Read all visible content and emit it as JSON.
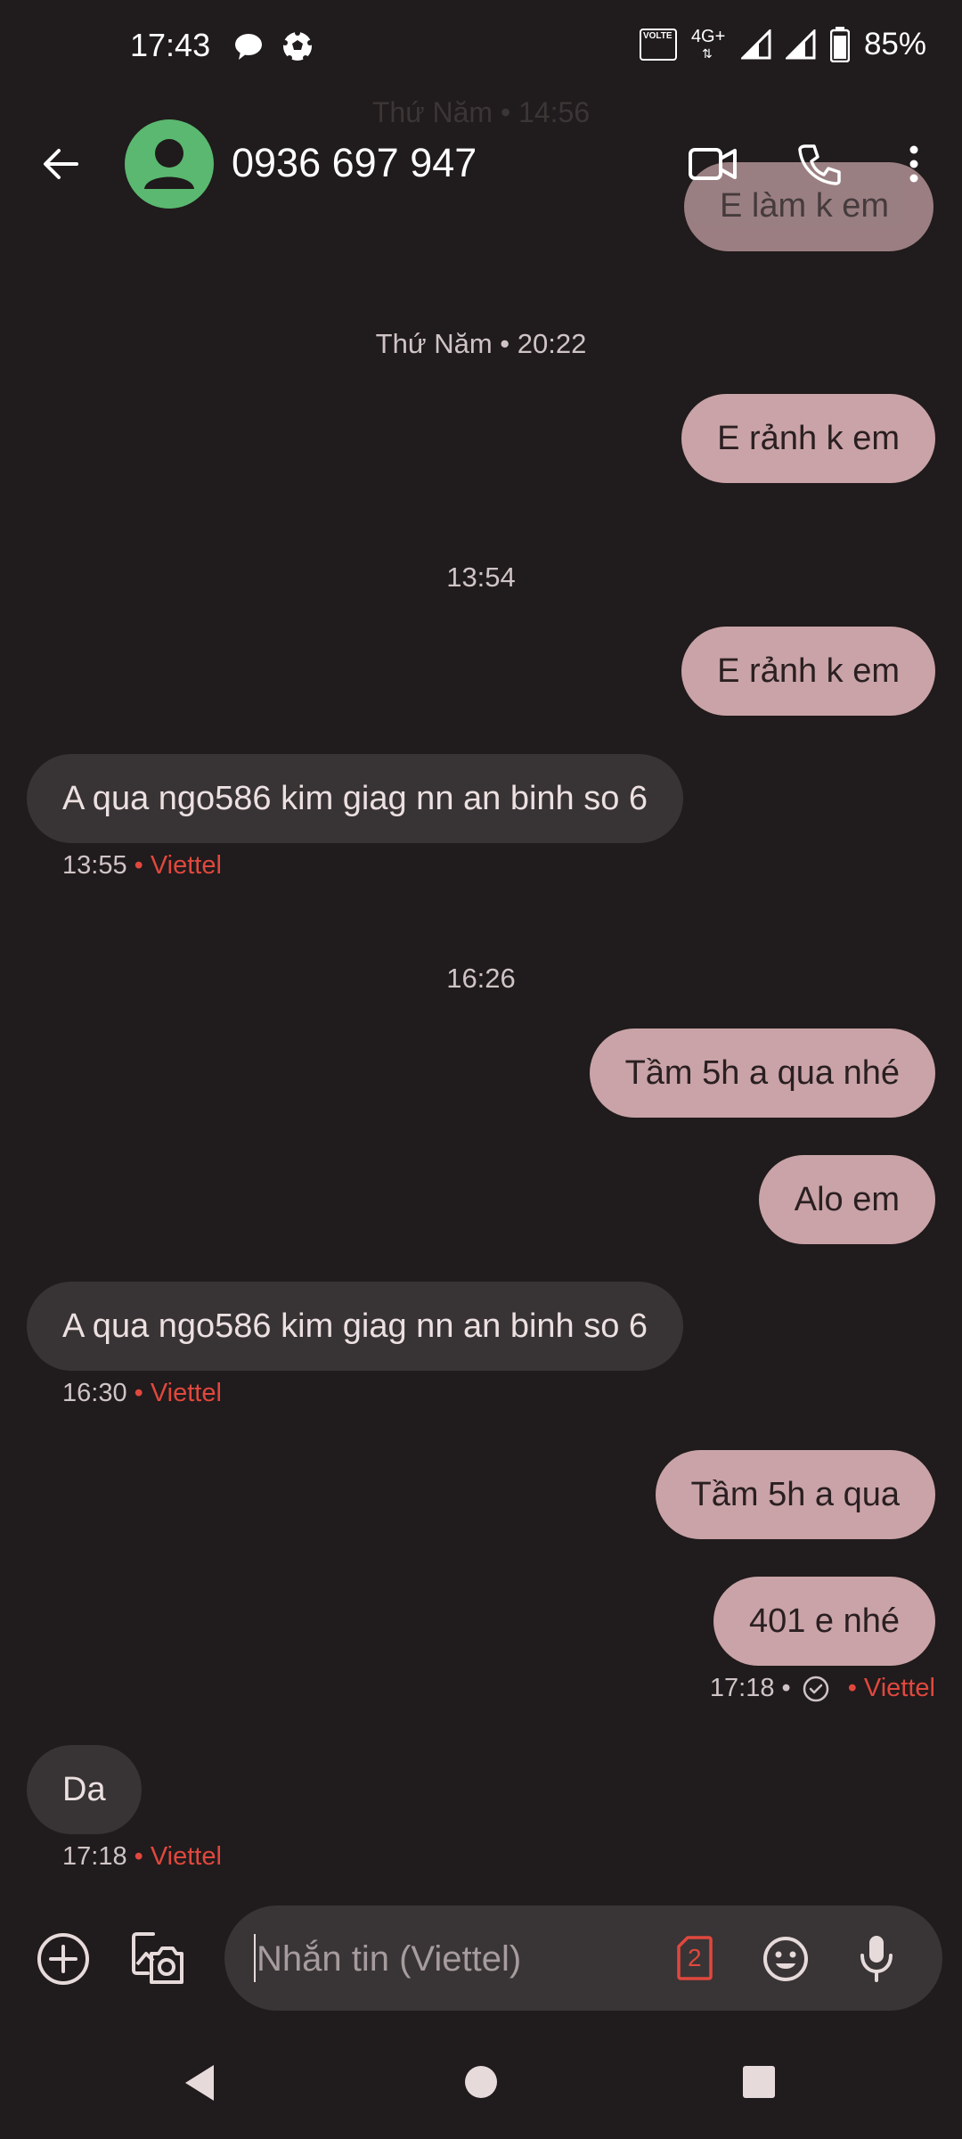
{
  "status_bar": {
    "time": "17:43",
    "network": "4G+",
    "volte": "VOLTE",
    "battery": "85%"
  },
  "header": {
    "contact": "0936 697 947",
    "ghost_date": "Thứ Năm • 14:56",
    "ghost_message": "E làm k em"
  },
  "conversation": {
    "divider_1": "Thứ Năm • 20:22",
    "msg_1": "E rảnh k em",
    "divider_2": "13:54",
    "msg_2": "E rảnh k em",
    "msg_3": "A qua ngo586 kim giag nn an binh so 6",
    "msg_3_time": "13:55",
    "msg_3_sim": "• Viettel",
    "divider_3": "16:26",
    "msg_4": "Tầm 5h a qua nhé",
    "msg_5": "Alo em",
    "msg_6": "A qua ngo586 kim giag nn an binh so 6",
    "msg_6_time": "16:30",
    "msg_6_sim": "• Viettel",
    "msg_7": "Tầm 5h a qua",
    "msg_8": "401 e nhé",
    "msg_8_time": "17:18 •",
    "msg_8_sim": "• Viettel",
    "msg_9": "Da",
    "msg_9_time": "17:18",
    "msg_9_sim": "• Viettel"
  },
  "compose": {
    "placeholder": "Nhắn tin (Viettel)",
    "sim_number": "2"
  },
  "colors": {
    "background": "#201b1c",
    "outgoing_bubble": "#c9a3a7",
    "incoming_bubble": "#383334",
    "sim_label": "#e0483e",
    "avatar": "#5ab870"
  }
}
